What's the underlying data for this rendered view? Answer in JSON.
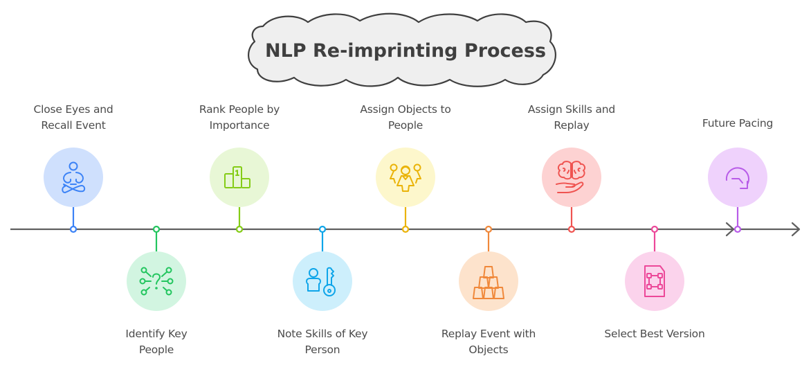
{
  "title": "NLP Re-imprinting Process",
  "timeline": {
    "line_color": "#5f5f5f",
    "steps": [
      {
        "label": "Close Eyes and Recall Event",
        "lines": [
          "Close Eyes and",
          "Recall Event"
        ],
        "position": "above",
        "icon": "meditation-icon",
        "color": "#3b82f6",
        "fill": "#cfe0fd"
      },
      {
        "label": "Identify Key People",
        "lines": [
          "Identify Key",
          "People"
        ],
        "position": "below",
        "icon": "network-question-icon",
        "color": "#22c55e",
        "fill": "#d2f5e1"
      },
      {
        "label": "Rank People by Importance",
        "lines": [
          "Rank People by",
          "Importance"
        ],
        "position": "above",
        "icon": "podium-icon",
        "color": "#84cc16",
        "fill": "#e8f7d6"
      },
      {
        "label": "Note Skills of Key Person",
        "lines": [
          "Note Skills of Key",
          "Person"
        ],
        "position": "below",
        "icon": "person-key-icon",
        "color": "#0ea5e9",
        "fill": "#cdeffc"
      },
      {
        "label": "Assign Objects to People",
        "lines": [
          "Assign Objects to",
          "People"
        ],
        "position": "above",
        "icon": "group-people-icon",
        "color": "#eab308",
        "fill": "#fdf7cc"
      },
      {
        "label": "Replay Event with Objects",
        "lines": [
          "Replay Event with",
          "Objects"
        ],
        "position": "below",
        "icon": "stacked-cups-icon",
        "color": "#f0883a",
        "fill": "#fde3cc"
      },
      {
        "label": "Assign Skills and Replay",
        "lines": [
          "Assign Skills and",
          "Replay"
        ],
        "position": "above",
        "icon": "brain-hand-icon",
        "color": "#ef5350",
        "fill": "#fdd2d2"
      },
      {
        "label": "Select Best Version",
        "lines": [
          "Select Best Version"
        ],
        "position": "below",
        "icon": "file-select-icon",
        "color": "#ec4899",
        "fill": "#fbd3ec"
      },
      {
        "label": "Future Pacing",
        "lines": [
          "Future Pacing"
        ],
        "position": "above",
        "icon": "rotate-arrow-icon",
        "color": "#b85ce8",
        "fill": "#efd2fc"
      }
    ]
  }
}
